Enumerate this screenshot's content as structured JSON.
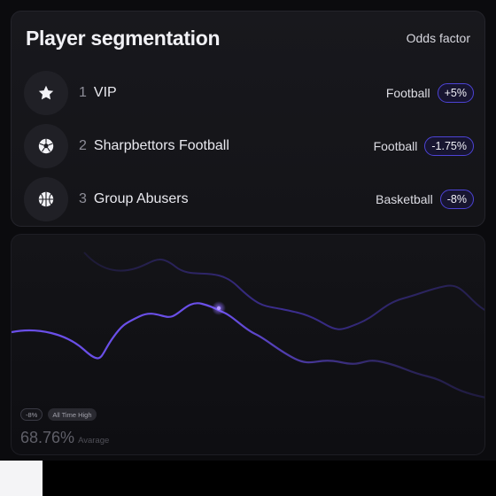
{
  "segmentation": {
    "title": "Player segmentation",
    "column_header": "Odds factor",
    "players": [
      {
        "rank": "1",
        "name": "VIP",
        "icon": "star-icon",
        "sport": "Football",
        "odds": "+5%"
      },
      {
        "rank": "2",
        "name": "Sharpbettors Football",
        "icon": "football-icon",
        "sport": "Football",
        "odds": "-1.75%"
      },
      {
        "rank": "3",
        "name": "Group Abusers",
        "icon": "basketball-icon",
        "sport": "Basketball",
        "odds": "-8%"
      }
    ]
  },
  "stats": {
    "change": "-8%",
    "tag": "All Time High",
    "average_value": "68.76%",
    "average_label": "Avarage"
  },
  "colors": {
    "accent": "#5b4ae0",
    "accent_line": "#6a4fe8",
    "card_bg": "#16161b"
  }
}
